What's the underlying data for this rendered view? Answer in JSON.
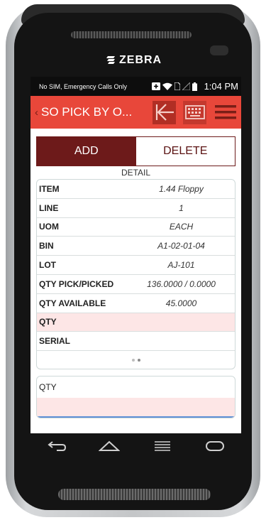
{
  "device": {
    "brand": "ZEBRA"
  },
  "status_bar": {
    "carrier_text": "No SIM, Emergency Calls Only",
    "time": "1:04 PM"
  },
  "toolbar": {
    "title": "SO PICK BY O..."
  },
  "segment": {
    "add_label": "ADD",
    "delete_label": "DELETE"
  },
  "detail": {
    "title": "DETAIL",
    "rows": [
      {
        "label": "ITEM",
        "value": "1.44 Floppy"
      },
      {
        "label": "LINE",
        "value": "1"
      },
      {
        "label": "UOM",
        "value": "EACH"
      },
      {
        "label": "BIN",
        "value": "A1-02-01-04"
      },
      {
        "label": "LOT",
        "value": "AJ-101"
      },
      {
        "label": "QTY PICK/PICKED",
        "value": "136.0000 / 0.0000"
      },
      {
        "label": "QTY AVAILABLE",
        "value": "45.0000"
      },
      {
        "label": "QTY",
        "value": ""
      },
      {
        "label": "SERIAL",
        "value": ""
      }
    ],
    "page_indicator": {
      "pages": 2,
      "current": 2
    }
  },
  "qty_entry": {
    "label": "QTY",
    "value": ""
  },
  "colors": {
    "toolbar": "#e8473a",
    "accent_dark": "#6d1a1a",
    "highlight_row": "#fde6e6",
    "input_underline": "#5b8fd6"
  },
  "icons": [
    "zebra-logo",
    "add-box-icon",
    "wifi-icon",
    "sim-icon",
    "signal-icon",
    "battery-icon",
    "back-arrow-icon",
    "keyboard-icon",
    "menu-icon",
    "nav-back-icon",
    "nav-home-icon",
    "nav-recents-icon",
    "nav-menu-icon"
  ]
}
